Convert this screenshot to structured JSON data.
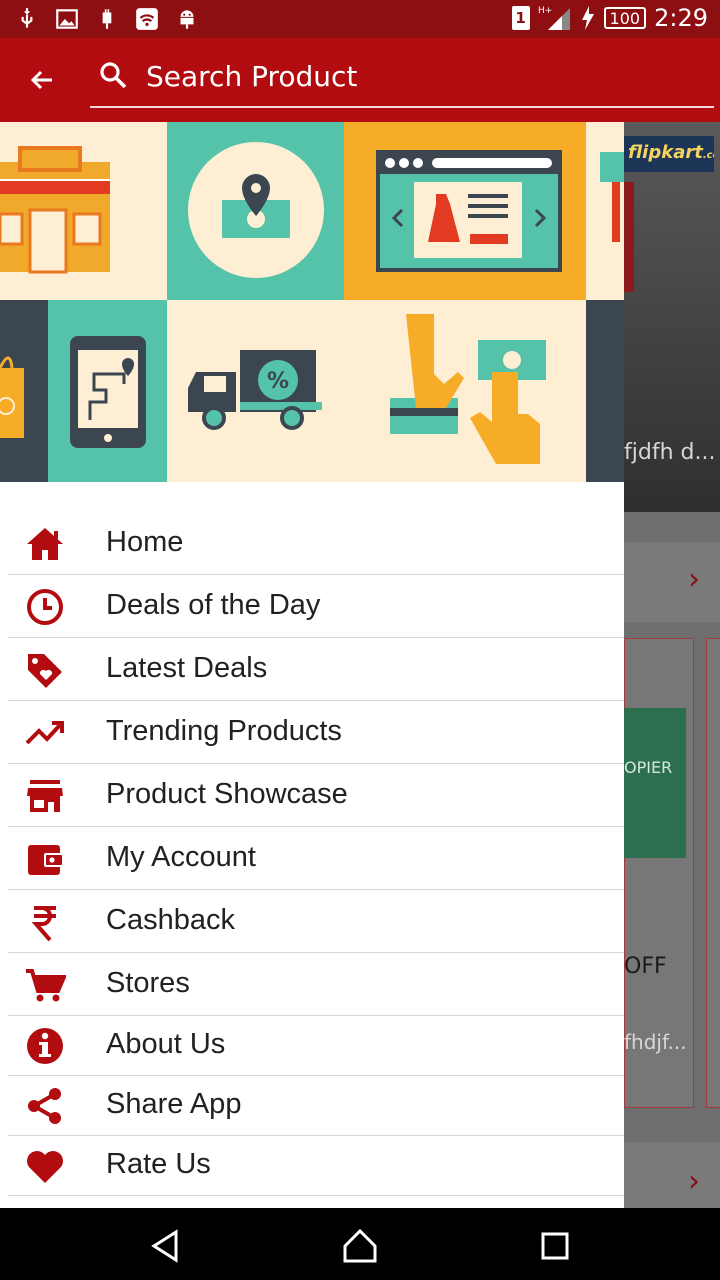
{
  "status_bar": {
    "time": "2:29",
    "battery": "100",
    "sim": "1",
    "network": "H+"
  },
  "search": {
    "placeholder": "Search Product"
  },
  "background": {
    "brand": "flipkart",
    "brand_suffix": ".com",
    "snippet_1": "fjdfh  d...",
    "product_text": "OPIER",
    "offer": "OFF",
    "snippet_2": "fhdjf..."
  },
  "menu": [
    {
      "label": "Home",
      "icon": "home-icon"
    },
    {
      "label": "Deals of the Day",
      "icon": "clock-icon"
    },
    {
      "label": "Latest Deals",
      "icon": "tag-icon"
    },
    {
      "label": "Trending Products",
      "icon": "trending-up-icon"
    },
    {
      "label": "Product Showcase",
      "icon": "store-icon"
    },
    {
      "label": "My Account",
      "icon": "wallet-icon"
    },
    {
      "label": "Cashback",
      "icon": "rupee-icon"
    },
    {
      "label": "Stores",
      "icon": "cart-icon"
    },
    {
      "label": "About Us",
      "icon": "info-icon"
    },
    {
      "label": "Share App",
      "icon": "share-icon"
    },
    {
      "label": "Rate Us",
      "icon": "heart-icon"
    }
  ],
  "colors": {
    "primary": "#b20c10",
    "primary_dark": "#8e0f12",
    "icon": "#b20c10"
  }
}
